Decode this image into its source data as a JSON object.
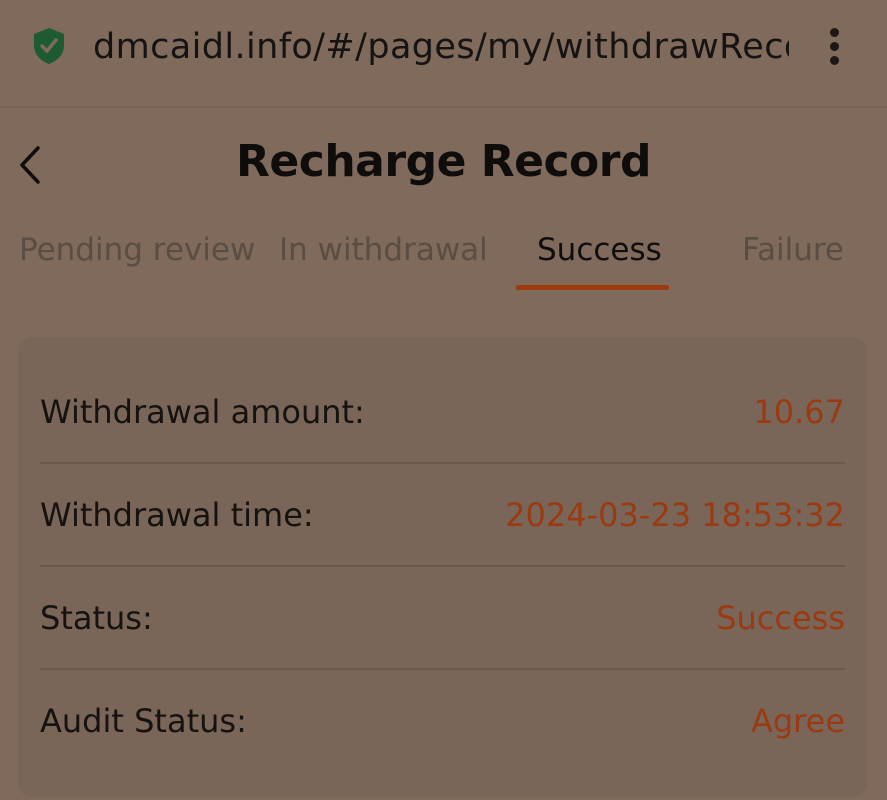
{
  "browser": {
    "url": "dmcaidl.info/#/pages/my/withdrawRecord",
    "security_icon": "shield-check-icon",
    "menu_icon": "kebab-menu-icon"
  },
  "header": {
    "title": "Recharge Record",
    "back_icon": "chevron-left-icon"
  },
  "tabs": [
    {
      "label": "Pending review",
      "active": false
    },
    {
      "label": "In withdrawal",
      "active": false
    },
    {
      "label": "Success",
      "active": true
    },
    {
      "label": "Failure",
      "active": false
    }
  ],
  "record": {
    "rows": [
      {
        "label": "Withdrawal amount:",
        "value": "10.67"
      },
      {
        "label": "Withdrawal time:",
        "value": "2024-03-23 18:53:32"
      },
      {
        "label": "Status:",
        "value": "Success"
      },
      {
        "label": "Audit Status:",
        "value": "Agree"
      }
    ]
  },
  "colors": {
    "accent": "#9d3a0e",
    "value_text": "#9a3a10",
    "background": "#7f6a5c",
    "shield": "#1e5a33"
  }
}
